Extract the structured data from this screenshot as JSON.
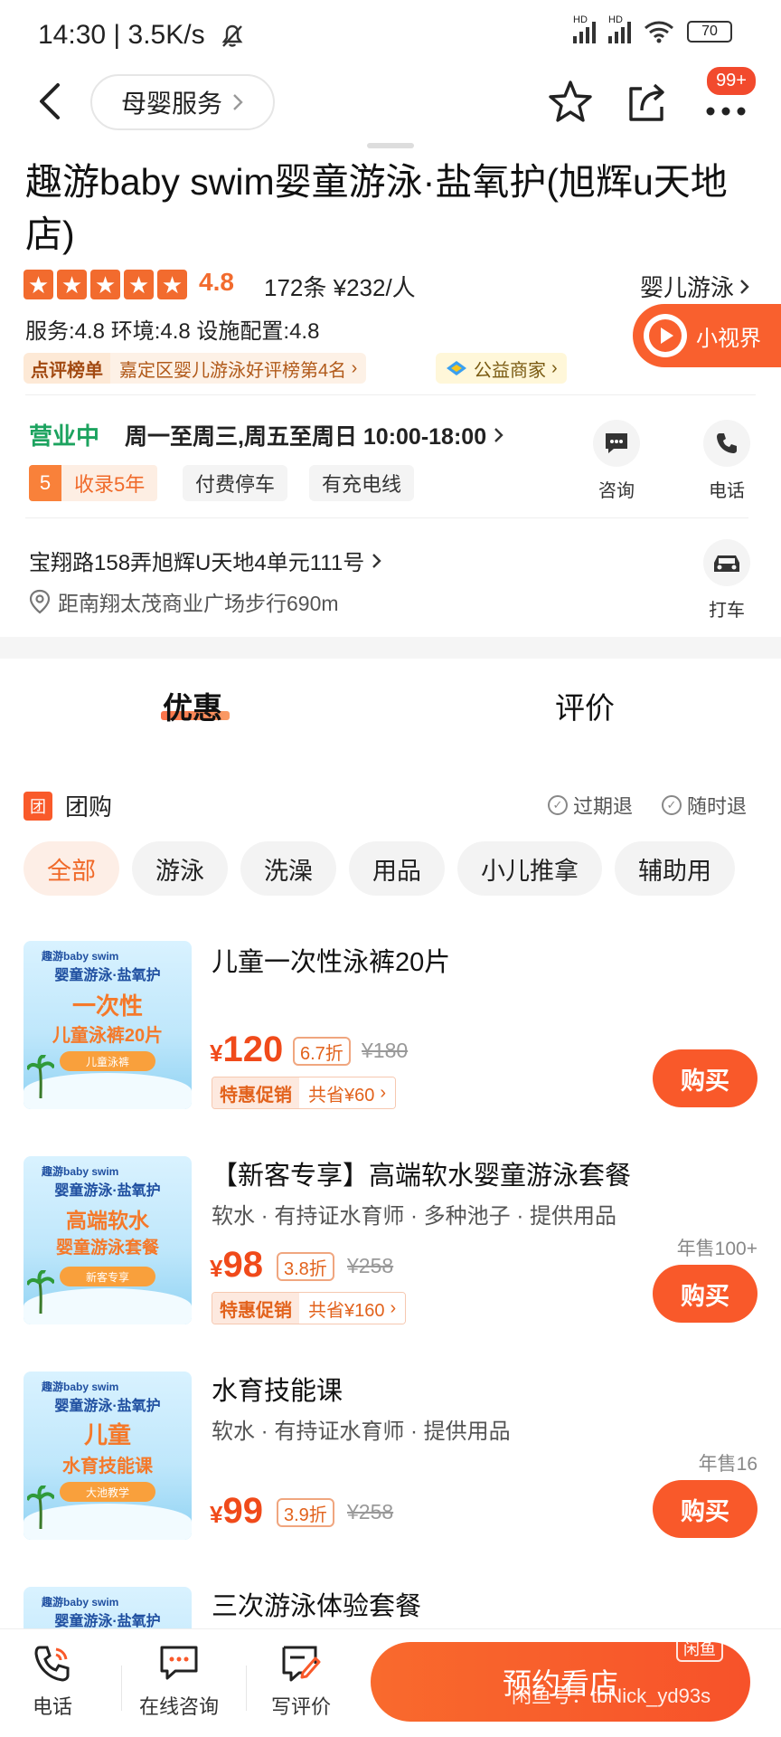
{
  "status_bar": {
    "time": "14:30 | 3.5K/s",
    "hd1": "HD",
    "hd2": "HD",
    "battery": "70"
  },
  "nav": {
    "category_chip": "母婴服务",
    "notification_badge": "99+"
  },
  "store": {
    "title": "趣游baby swim婴童游泳·盐氧护(旭辉u天地店)",
    "rating": "4.8",
    "reviews_price": "172条  ¥232/人",
    "category_link": "婴儿游泳",
    "scores": "服务:4.8  环境:4.8  设施配置:4.8",
    "mini_video": "小视界",
    "rank_label": "点评榜单",
    "rank_text": "嘉定区婴儿游泳好评榜第4名",
    "charity": "公益商家",
    "open_status": "营业中",
    "hours": "周一至周三,周五至周日 10:00-18:00",
    "years_num": "5",
    "years_text": "收录5年",
    "facilities": [
      "付费停车",
      "有充电线"
    ],
    "consult_label": "咨询",
    "phone_label": "电话",
    "address": "宝翔路158弄旭辉U天地4单元111号",
    "distance": "距南翔太茂商业广场步行690m",
    "taxi_label": "打车"
  },
  "tabs": [
    "优惠",
    "评价"
  ],
  "group_buy": {
    "icon_text": "团",
    "title": "团购",
    "policy1": "过期退",
    "policy2": "随时退",
    "filters": [
      "全部",
      "游泳",
      "洗澡",
      "用品",
      "小儿推拿",
      "辅助用"
    ]
  },
  "thumb_common": {
    "brand": "趣游baby swim",
    "brand2": "婴童游泳·盐氧护"
  },
  "deals": [
    {
      "title": "儿童一次性泳裤20片",
      "thumb_line1": "一次性",
      "thumb_line2": "儿童泳裤20片",
      "thumb_pill": "儿童泳裤",
      "price": "120",
      "discount": "6.7折",
      "original": "¥180",
      "promo_label": "特惠促销",
      "promo_value": "共省¥60",
      "buy": "购买"
    },
    {
      "title": "【新客专享】高端软水婴童游泳套餐",
      "subtitle": "软水 · 有持证水育师 · 多种池子 · 提供用品",
      "thumb_line1": "高端软水",
      "thumb_line2": "婴童游泳套餐",
      "thumb_pill": "新客专享",
      "price": "98",
      "discount": "3.8折",
      "original": "¥258",
      "promo_label": "特惠促销",
      "promo_value": "共省¥160",
      "sales": "年售100+",
      "buy": "购买"
    },
    {
      "title": "水育技能课",
      "subtitle": "软水 · 有持证水育师 · 提供用品",
      "thumb_line1": "儿童",
      "thumb_line2": "水育技能课",
      "thumb_pill": "大池教学",
      "price": "99",
      "discount": "3.9折",
      "original": "¥258",
      "sales": "年售16",
      "buy": "购买"
    },
    {
      "title": "三次游泳体验套餐"
    }
  ],
  "currency": "¥",
  "bottom_bar": {
    "phone": "电话",
    "online_consult": "在线咨询",
    "write_review": "写评价",
    "reserve": "预约看店",
    "watermark": "闲鱼号：tbNick_yd93s",
    "xianyu": "闲鱼"
  },
  "colors": {
    "accent": "#f9592a",
    "open_green": "#1ca35f",
    "rating_orange": "#f26b2e"
  }
}
